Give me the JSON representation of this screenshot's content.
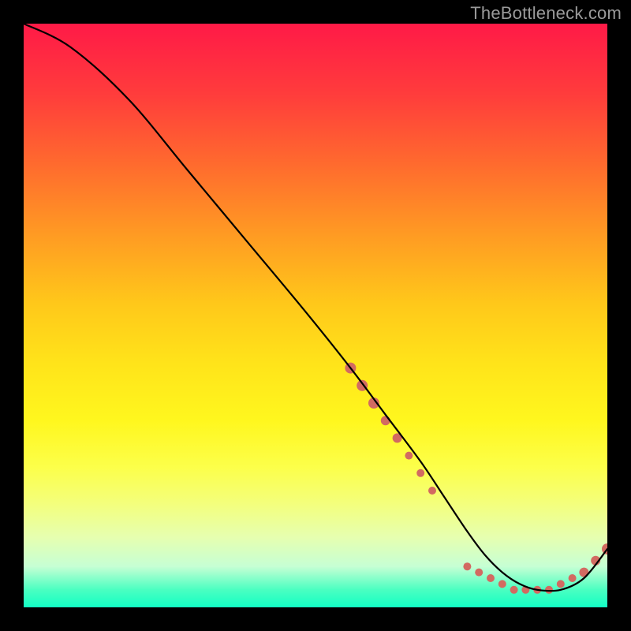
{
  "watermark": "TheBottleneck.com",
  "chart_data": {
    "type": "line",
    "title": "",
    "xlabel": "",
    "ylabel": "",
    "xlim": [
      0,
      100
    ],
    "ylim": [
      0,
      100
    ],
    "grid": false,
    "series": [
      {
        "name": "curve",
        "color": "#000000",
        "x": [
          0,
          8,
          18,
          28,
          38,
          48,
          56,
          62,
          68,
          72,
          76,
          79,
          82,
          85,
          88,
          92,
          96,
          100
        ],
        "y": [
          100,
          96,
          87,
          75,
          63,
          51,
          41,
          33,
          25,
          19,
          13,
          9,
          6,
          4,
          3,
          3,
          5,
          10
        ]
      }
    ],
    "markers": [
      {
        "x": 56,
        "y": 41,
        "r": 7,
        "color": "#d26a61"
      },
      {
        "x": 58,
        "y": 38,
        "r": 7,
        "color": "#d26a61"
      },
      {
        "x": 60,
        "y": 35,
        "r": 7,
        "color": "#d26a61"
      },
      {
        "x": 62,
        "y": 32,
        "r": 6,
        "color": "#d26a61"
      },
      {
        "x": 64,
        "y": 29,
        "r": 6,
        "color": "#d26a61"
      },
      {
        "x": 66,
        "y": 26,
        "r": 5,
        "color": "#d26a61"
      },
      {
        "x": 68,
        "y": 23,
        "r": 5,
        "color": "#d26a61"
      },
      {
        "x": 70,
        "y": 20,
        "r": 5,
        "color": "#d26a61"
      },
      {
        "x": 76,
        "y": 7,
        "r": 5,
        "color": "#d26a61"
      },
      {
        "x": 78,
        "y": 6,
        "r": 5,
        "color": "#d26a61"
      },
      {
        "x": 80,
        "y": 5,
        "r": 5,
        "color": "#d26a61"
      },
      {
        "x": 82,
        "y": 4,
        "r": 5,
        "color": "#d26a61"
      },
      {
        "x": 84,
        "y": 3,
        "r": 5,
        "color": "#d26a61"
      },
      {
        "x": 86,
        "y": 3,
        "r": 5,
        "color": "#d26a61"
      },
      {
        "x": 88,
        "y": 3,
        "r": 5,
        "color": "#d26a61"
      },
      {
        "x": 90,
        "y": 3,
        "r": 5,
        "color": "#d26a61"
      },
      {
        "x": 92,
        "y": 4,
        "r": 5,
        "color": "#d26a61"
      },
      {
        "x": 94,
        "y": 5,
        "r": 5,
        "color": "#d26a61"
      },
      {
        "x": 96,
        "y": 6,
        "r": 6,
        "color": "#d26a61"
      },
      {
        "x": 98,
        "y": 8,
        "r": 6,
        "color": "#d26a61"
      },
      {
        "x": 100,
        "y": 10,
        "r": 7,
        "color": "#d26a61"
      }
    ]
  }
}
